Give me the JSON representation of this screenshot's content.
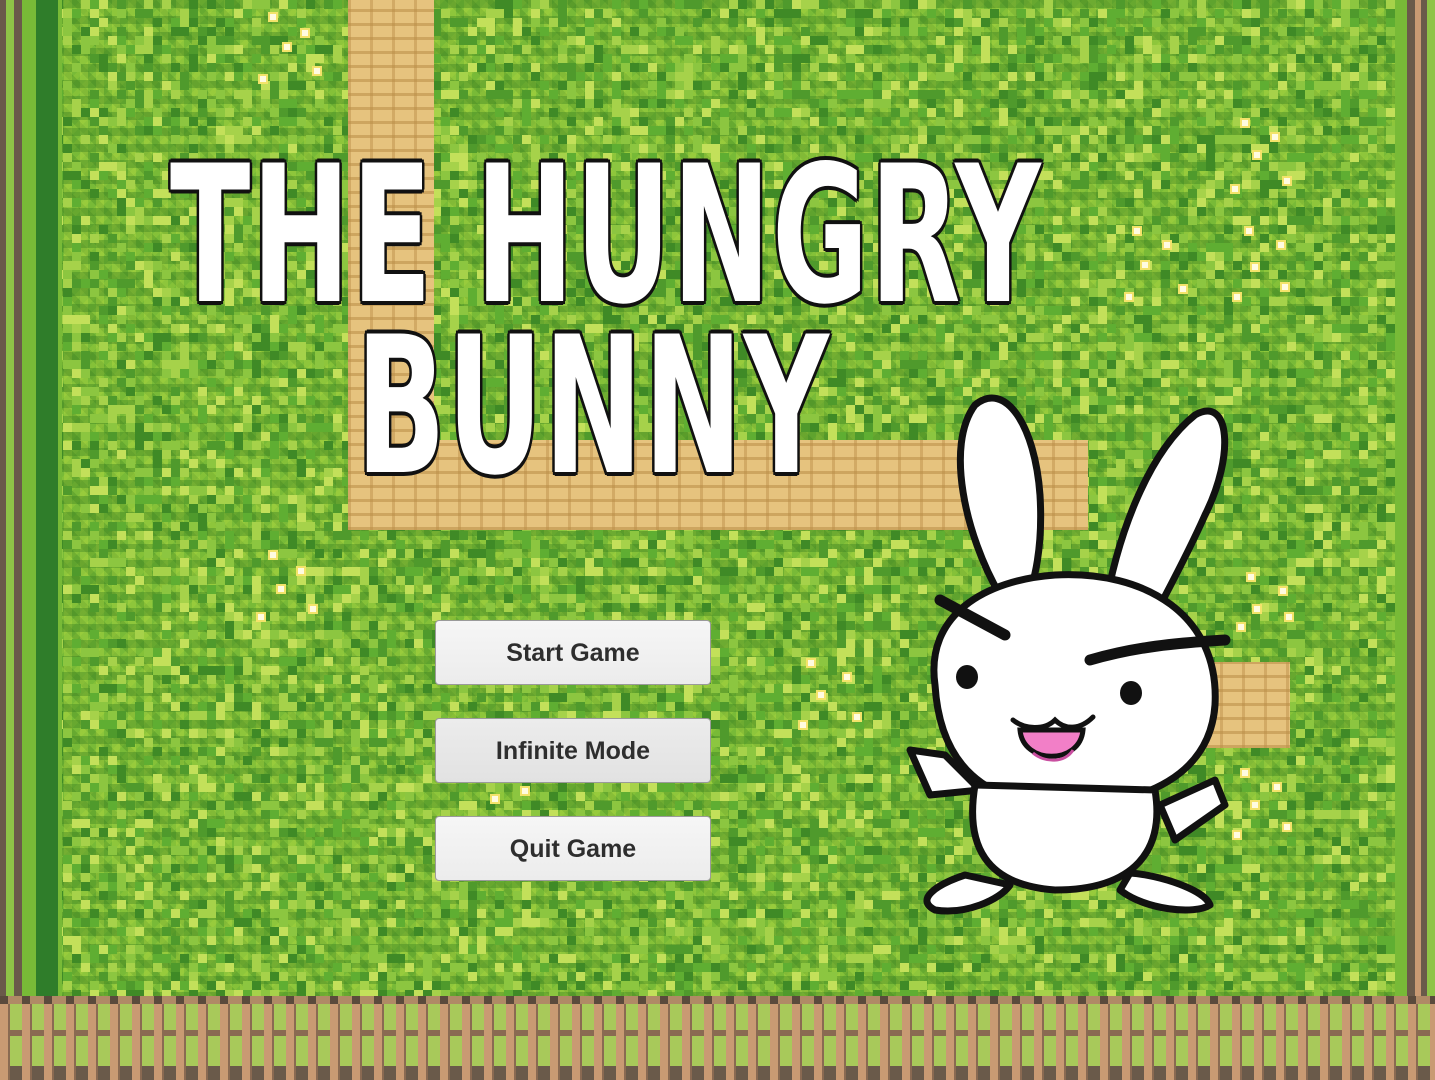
{
  "title": {
    "line1": "THE HUNGRY",
    "line2": "BUNNY"
  },
  "menu": {
    "start_label": "Start Game",
    "infinite_label": "Infinite Mode",
    "quit_label": "Quit Game"
  },
  "colors": {
    "grass": "#78ba37",
    "dirt_path": "#e6c37e",
    "button_bg": "#f2f2f2",
    "button_text": "#2e2e2e",
    "title_fill": "#ffffff",
    "title_outline": "#111111"
  },
  "icons": {
    "mascot": "bunny-mascot-icon",
    "flower": "flower-icon"
  }
}
